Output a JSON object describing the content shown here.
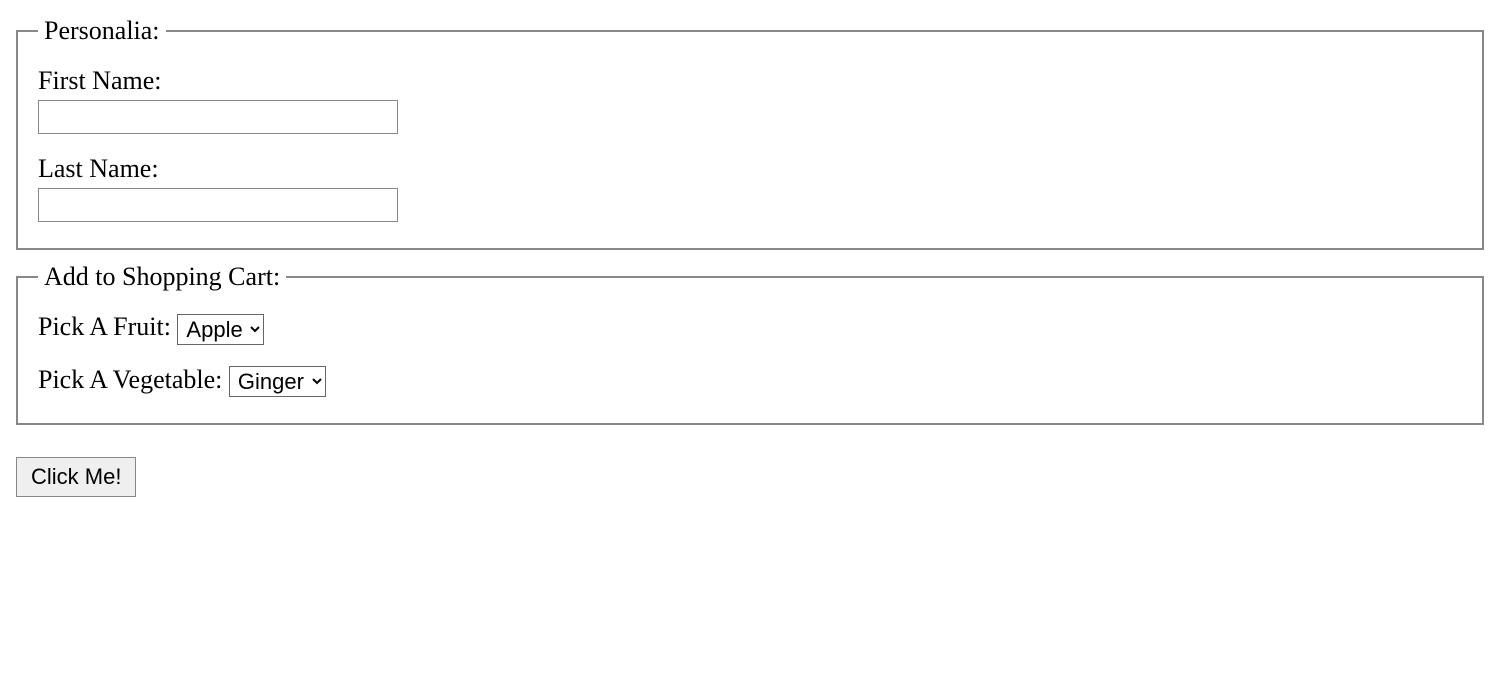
{
  "personalia": {
    "legend": "Personalia:",
    "first_name_label": "First Name:",
    "first_name_value": "",
    "last_name_label": "Last Name:",
    "last_name_value": ""
  },
  "cart": {
    "legend": "Add to Shopping Cart:",
    "fruit_label": "Pick A Fruit: ",
    "fruit_selected": "Apple",
    "vegetable_label": "Pick A Vegetable: ",
    "vegetable_selected": "Ginger"
  },
  "button_label": "Click Me!"
}
